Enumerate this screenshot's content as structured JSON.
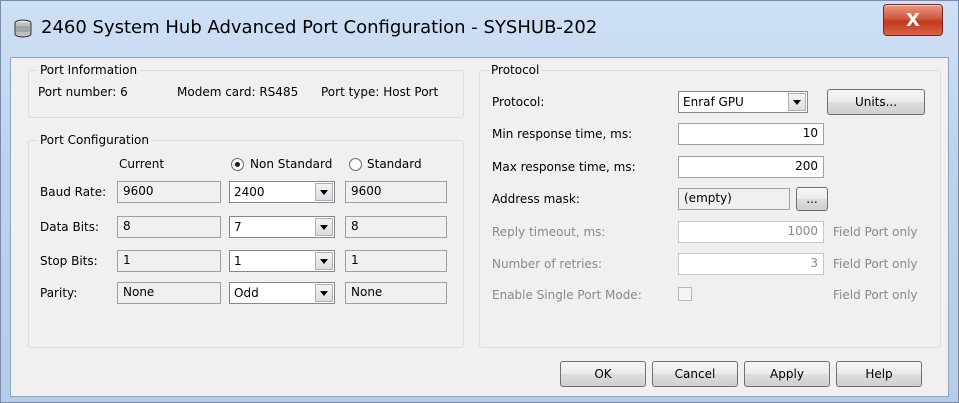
{
  "window": {
    "title": "2460 System Hub Advanced Port Configuration - SYSHUB-202",
    "close_label": "X"
  },
  "port_info": {
    "title": "Port Information",
    "port_number": "Port number:  6",
    "modem_card": "Modem card:  RS485",
    "port_type": "Port type:  Host Port"
  },
  "port_config": {
    "title": "Port Configuration",
    "current_header": "Current",
    "non_standard_label": "Non Standard",
    "standard_label": "Standard",
    "selected_mode": "Non Standard",
    "rows": [
      {
        "label": "Baud Rate:",
        "current": "9600",
        "selected": "2400",
        "standard": "9600"
      },
      {
        "label": "Data Bits:",
        "current": "8",
        "selected": "7",
        "standard": "8"
      },
      {
        "label": "Stop Bits:",
        "current": "1",
        "selected": "1",
        "standard": "1"
      },
      {
        "label": "Parity:",
        "current": "None",
        "selected": "Odd",
        "standard": "None"
      }
    ]
  },
  "protocol": {
    "title": "Protocol",
    "protocol_label": "Protocol:",
    "protocol_value": "Enraf GPU",
    "units_button": "Units...",
    "min_response_label": "Min response time, ms:",
    "min_response_value": "10",
    "max_response_label": "Max response time, ms:",
    "max_response_value": "200",
    "address_mask_label": "Address mask:",
    "address_mask_value": "(empty)",
    "address_mask_button": "...",
    "reply_timeout_label": "Reply timeout, ms:",
    "reply_timeout_value": "1000",
    "retries_label": "Number of retries:",
    "retries_value": "3",
    "single_port_label": "Enable Single Port Mode:",
    "field_port_only": "Field Port only"
  },
  "buttons": {
    "ok": "OK",
    "cancel": "Cancel",
    "apply": "Apply",
    "help": "Help"
  }
}
